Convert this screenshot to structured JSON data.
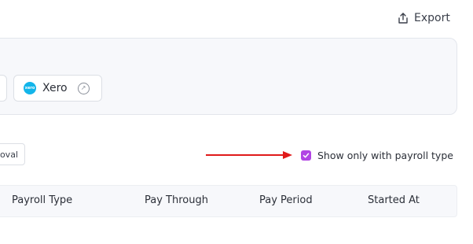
{
  "header": {
    "export_label": "Export"
  },
  "integrations": {
    "items": [
      {
        "label": "Xero",
        "logo_text": "xero",
        "logo_color": "#13b5ea"
      }
    ]
  },
  "filters": {
    "pill_partial_label": "oval",
    "payroll_checkbox": {
      "label": "Show only with payroll type",
      "checked": true,
      "color": "#b144e4"
    }
  },
  "annotation": {
    "arrow_color": "#e01a1a"
  },
  "table": {
    "columns": [
      "Payroll Type",
      "Pay Through",
      "Pay Period",
      "Started At"
    ]
  }
}
